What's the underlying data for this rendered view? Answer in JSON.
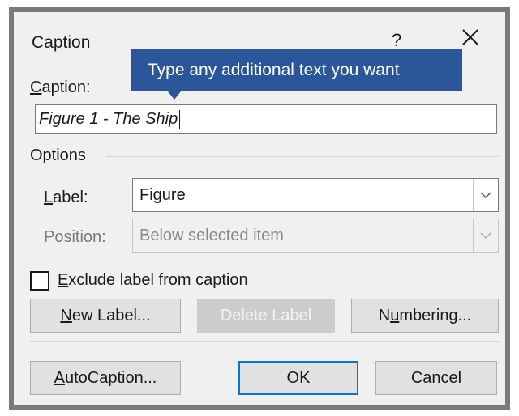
{
  "dialog": {
    "title": "Caption",
    "help_glyph": "?",
    "close_icon": "close-icon"
  },
  "tooltip": {
    "text": "Type any additional text you want"
  },
  "caption": {
    "label_accel": "C",
    "label_rest": "aption:",
    "value": "Figure 1 - The Ship"
  },
  "options": {
    "group_label": "Options",
    "label_field": {
      "label_accel": "L",
      "label_rest": "abel:",
      "value": "Figure"
    },
    "position_field": {
      "label": "Position:",
      "value": "Below selected item"
    },
    "exclude_checkbox": {
      "label_accel": "E",
      "label_rest": "xclude label from caption",
      "checked": false
    }
  },
  "buttons": {
    "new_label_accel": "N",
    "new_label_rest": "ew Label...",
    "delete_label": "Delete Label",
    "numbering_pre": "N",
    "numbering_accel": "u",
    "numbering_post": "mbering...",
    "autocaption_accel": "A",
    "autocaption_rest": "utoCaption...",
    "ok": "OK",
    "cancel": "Cancel"
  },
  "colors": {
    "tooltip_bg": "#2b579a",
    "default_button_border": "#0078d7",
    "dialog_bg": "#f0f0f0"
  }
}
